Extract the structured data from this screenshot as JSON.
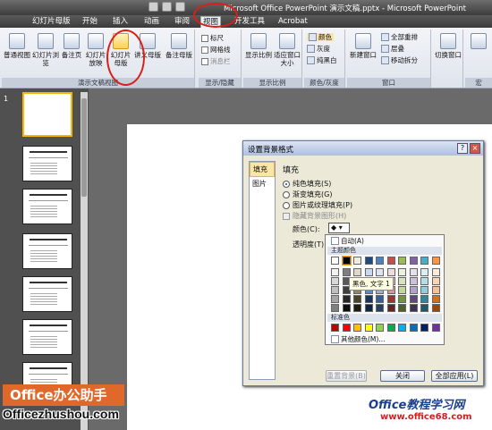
{
  "window": {
    "title": "Microsoft Office PowerPoint 演示文稿.pptx - Microsoft PowerPoint"
  },
  "tabs": [
    {
      "label": "幻灯片母版",
      "active": false
    },
    {
      "label": "开始",
      "active": false
    },
    {
      "label": "插入",
      "active": false
    },
    {
      "label": "动画",
      "active": false
    },
    {
      "label": "审阅",
      "active": false
    },
    {
      "label": "视图",
      "active": true
    },
    {
      "label": "开发工具",
      "active": false
    },
    {
      "label": "Acrobat",
      "active": false
    }
  ],
  "ribbon": {
    "views": {
      "buttons": [
        "普通视图",
        "幻灯片浏览",
        "备注页",
        "幻灯片放映",
        "幻灯片母版",
        "讲义母版",
        "备注母版"
      ],
      "label": "演示文稿视图"
    },
    "show": {
      "items": [
        "标尺",
        "网格线",
        "消息栏"
      ],
      "label": "显示/隐藏"
    },
    "zoom": {
      "buttons": [
        "显示比例",
        "适应窗口大小"
      ],
      "label": "显示比例"
    },
    "color": {
      "items": [
        "颜色",
        "灰度",
        "纯黑白"
      ],
      "label": "颜色/灰度"
    },
    "window": {
      "buttons": [
        "新建窗口"
      ],
      "items": [
        "全部重排",
        "层叠",
        "移动拆分"
      ],
      "label": "窗口"
    },
    "switch": {
      "label_btn": "切换窗口"
    },
    "macro": {
      "label": "宏"
    }
  },
  "slide_panel": {
    "first_slide_number": "1"
  },
  "dialog": {
    "title": "设置背景格式",
    "categories": [
      "填充",
      "图片"
    ],
    "heading": "填充",
    "options": [
      "纯色填充(S)",
      "渐变填充(G)",
      "图片或纹理填充(P)"
    ],
    "hide_bg": "隐藏背景图形(H)",
    "color_label": "颜色(C):",
    "transparency_label": "透明度(T):",
    "palette": {
      "auto": "自动(A)",
      "theme_colors": "主题颜色",
      "tooltip": "黑色, 文字 1",
      "standard_colors": "标准色",
      "more": "其他颜色(M)..."
    },
    "buttons": {
      "reset": "重置背景(B)",
      "close": "关闭",
      "apply_all": "全部应用(L)"
    }
  },
  "watermarks": {
    "office_helper": "Office办公助手",
    "office_url": "Officezhushou.com",
    "site_name": "Office教程学习网",
    "site_url": "www.office68.com"
  },
  "colors": {
    "accent": "#d8201a",
    "ribbon": "#dfe4ec",
    "dialog": "#ece9d8"
  }
}
